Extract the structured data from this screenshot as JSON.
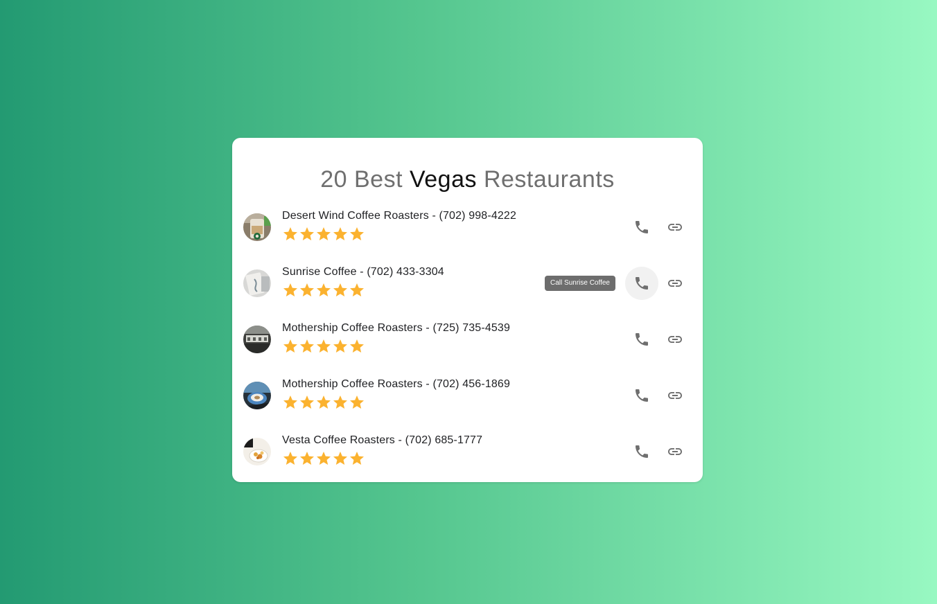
{
  "card": {
    "title_prefix": "20 Best ",
    "title_accent": "Vegas",
    "title_suffix": " Restaurants"
  },
  "colors": {
    "background_start": "#239a72",
    "background_end": "#98f8c2",
    "star": "#fbb22f",
    "icon": "#6f6f6f",
    "tooltip_bg": "#616161"
  },
  "icons": {
    "phone": "phone-icon",
    "link": "link-icon",
    "star": "star-icon"
  },
  "restaurants": [
    {
      "name": "Desert Wind Coffee Roasters",
      "phone": "(702) 998-4222",
      "rating": 5,
      "rating_max": 5
    },
    {
      "name": "Sunrise Coffee",
      "phone": "(702) 433-3304",
      "rating": 5,
      "rating_max": 5,
      "tooltip": "Call Sunrise Coffee"
    },
    {
      "name": "Mothership Coffee Roasters",
      "phone": "(725) 735-4539",
      "rating": 5,
      "rating_max": 5
    },
    {
      "name": "Mothership Coffee Roasters",
      "phone": "(702) 456-1869",
      "rating": 5,
      "rating_max": 5
    },
    {
      "name": "Vesta Coffee Roasters",
      "phone": "(702) 685-1777",
      "rating": 5,
      "rating_max": 5
    }
  ]
}
